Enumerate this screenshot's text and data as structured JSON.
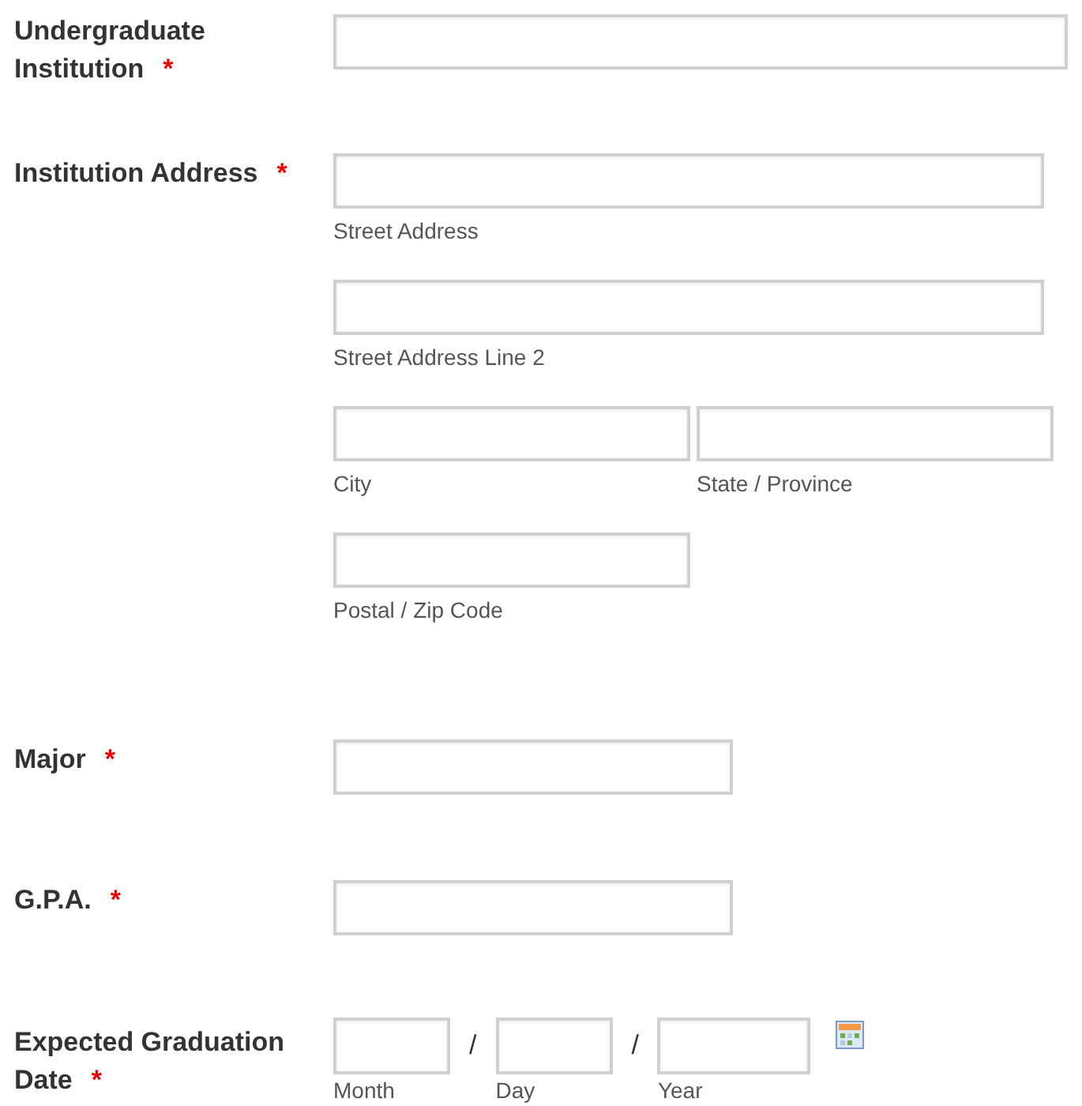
{
  "fields": [
    {
      "kind": "text",
      "label": "Undergraduate Institution",
      "required_mark": "*"
    },
    {
      "kind": "address",
      "label": "Institution Address",
      "required_mark": "*",
      "parts": [
        {
          "sublabel": "Street Address"
        },
        {
          "sublabel": "Street Address Line 2"
        },
        {
          "sublabel": "City",
          "sublabel_2": "State / Province"
        },
        {
          "sublabel": "Postal / Zip Code"
        }
      ]
    },
    {
      "kind": "text",
      "label": "Major",
      "required_mark": "*"
    },
    {
      "kind": "text",
      "label": "G.P.A.",
      "required_mark": "*"
    },
    {
      "kind": "date",
      "label": "Expected Graduation Date",
      "required_mark": "*",
      "separator": "/",
      "parts": [
        {
          "sublabel": "Month"
        },
        {
          "sublabel": "Day"
        },
        {
          "sublabel": "Year"
        }
      ]
    }
  ]
}
